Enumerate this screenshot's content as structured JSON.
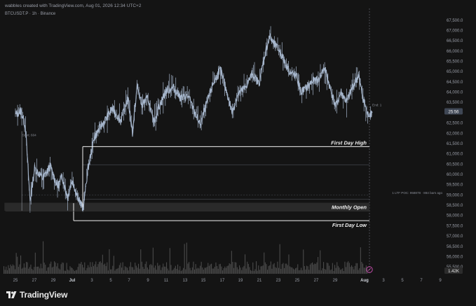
{
  "header": {
    "creator_line": "wabbles created with TradingView.com, Aug 01, 2026 12:34 UTC+2",
    "symbol_line": "BTCUSDT.P · 1h · Binance"
  },
  "chart_data": {
    "type": "candlestick",
    "symbol": "BTCUSDT.P",
    "timeframe": "1h",
    "exchange": "Binance",
    "ylim": [
      55300,
      67800
    ],
    "y_ticks": [
      "67,500.0",
      "67,000.0",
      "66,500.0",
      "66,000.0",
      "65,500.0",
      "65,000.0",
      "64,500.0",
      "64,000.0",
      "63,500.0",
      "63,000.0",
      "62,500.0",
      "62,000.0",
      "61,500.0",
      "61,000.0",
      "60,500.0",
      "60,000.0",
      "59,500.0",
      "59,000.0",
      "58,500.0",
      "58,000.0",
      "57,500.0",
      "57,000.0",
      "56,500.0",
      "56,000.0",
      "55,500.0"
    ],
    "x_ticks": [
      "25",
      "27",
      "29",
      "Jul",
      "3",
      "5",
      "7",
      "9",
      "11",
      "13",
      "15",
      "17",
      "19",
      "21",
      "23",
      "25",
      "27",
      "29",
      "Aug",
      "3",
      "5",
      "7",
      "9"
    ],
    "price_path": [
      {
        "day": 0,
        "price": 62900
      },
      {
        "day": 0.6,
        "price": 63100
      },
      {
        "day": 1.1,
        "price": 62300
      },
      {
        "day": 1.6,
        "price": 58700
      },
      {
        "day": 2.1,
        "price": 60300
      },
      {
        "day": 3.0,
        "price": 59800
      },
      {
        "day": 3.8,
        "price": 60400
      },
      {
        "day": 4.6,
        "price": 59400
      },
      {
        "day": 5.1,
        "price": 59900
      },
      {
        "day": 5.7,
        "price": 58900
      },
      {
        "day": 6.2,
        "price": 59700
      },
      {
        "day": 7.0,
        "price": 58700
      },
      {
        "day": 7.4,
        "price": 58300
      },
      {
        "day": 7.9,
        "price": 60200
      },
      {
        "day": 8.6,
        "price": 61800
      },
      {
        "day": 9.6,
        "price": 62500
      },
      {
        "day": 10.6,
        "price": 63200
      },
      {
        "day": 11.5,
        "price": 62600
      },
      {
        "day": 12.3,
        "price": 63700
      },
      {
        "day": 12.8,
        "price": 62000
      },
      {
        "day": 13.3,
        "price": 64300
      },
      {
        "day": 13.8,
        "price": 63400
      },
      {
        "day": 14.5,
        "price": 63700
      },
      {
        "day": 15.1,
        "price": 62500
      },
      {
        "day": 15.7,
        "price": 63300
      },
      {
        "day": 16.5,
        "price": 64100
      },
      {
        "day": 17.3,
        "price": 64200
      },
      {
        "day": 18.1,
        "price": 63700
      },
      {
        "day": 18.9,
        "price": 63800
      },
      {
        "day": 19.6,
        "price": 63000
      },
      {
        "day": 20.2,
        "price": 62400
      },
      {
        "day": 20.8,
        "price": 63300
      },
      {
        "day": 21.6,
        "price": 64400
      },
      {
        "day": 22.4,
        "price": 65100
      },
      {
        "day": 23.1,
        "price": 64000
      },
      {
        "day": 23.7,
        "price": 63000
      },
      {
        "day": 24.3,
        "price": 63900
      },
      {
        "day": 25.1,
        "price": 64200
      },
      {
        "day": 25.9,
        "price": 64900
      },
      {
        "day": 26.6,
        "price": 64400
      },
      {
        "day": 27.3,
        "price": 65900
      },
      {
        "day": 27.8,
        "price": 66700
      },
      {
        "day": 28.3,
        "price": 66300
      },
      {
        "day": 28.9,
        "price": 66000
      },
      {
        "day": 29.5,
        "price": 65400
      },
      {
        "day": 30.1,
        "price": 64900
      },
      {
        "day": 30.7,
        "price": 64800
      },
      {
        "day": 31.2,
        "price": 64000
      },
      {
        "day": 31.8,
        "price": 64200
      },
      {
        "day": 32.4,
        "price": 64500
      },
      {
        "day": 33.1,
        "price": 64600
      },
      {
        "day": 33.8,
        "price": 65200
      },
      {
        "day": 34.4,
        "price": 64200
      },
      {
        "day": 35.0,
        "price": 63300
      },
      {
        "day": 35.6,
        "price": 64000
      },
      {
        "day": 36.2,
        "price": 63500
      },
      {
        "day": 36.9,
        "price": 64300
      },
      {
        "day": 37.5,
        "price": 64800
      },
      {
        "day": 38.0,
        "price": 63700
      },
      {
        "day": 38.5,
        "price": 62900
      },
      {
        "day": 39.0,
        "price": 63000
      }
    ],
    "price_high": 66900,
    "price_low": 57950,
    "levels": [
      {
        "label": "First Day High",
        "price": 61350
      },
      {
        "label": "Monthly Open",
        "price": 58420
      },
      {
        "label": "First Day Low",
        "price": 57750
      }
    ],
    "inner_lines": [
      {
        "price": 60470
      },
      {
        "price": 58800
      }
    ],
    "start_label": "Start: 604",
    "end_label": "End: 1",
    "ltf_label": "1 LTF POC: 958878 · 884 bars ago",
    "current_price_tag": "25:56",
    "volume_tag": "1.42K",
    "colors": {
      "background": "#141414",
      "candles": "#a6b6cc",
      "volume": "#4a4a4a",
      "level_lines": "#f0f0f0",
      "zone_fill": "#2a2a2a",
      "price_tag_bg": "#3f4755"
    }
  },
  "footer": {
    "brand": "TradingView"
  }
}
